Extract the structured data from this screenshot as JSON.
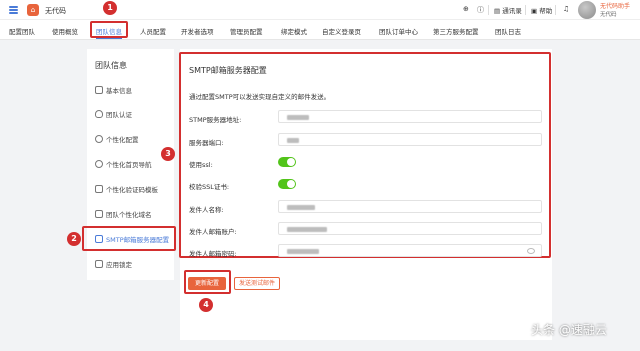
{
  "app": {
    "title": "无代码",
    "home_glyph": "⌂"
  },
  "top_right": {
    "address_book": "通讯录",
    "help": "帮助",
    "user_name": "无代码助手",
    "user_role": "无代码"
  },
  "nav": {
    "tabs": [
      "配置团队",
      "使用概览",
      "团队信息",
      "人员配置",
      "开发者选项",
      "管理员配置",
      "绑定模式",
      "自定义登录页",
      "团队订单中心",
      "第三方服务配置",
      "团队日志"
    ],
    "active_tab": "团队信息"
  },
  "left": {
    "title": "团队信息",
    "items": [
      "基本信息",
      "团队认证",
      "个性化配置",
      "个性化首页导航",
      "个性化验证码模板",
      "团队个性化域名",
      "SMTP邮箱服务器配置",
      "应用锁定"
    ],
    "active_item": "SMTP邮箱服务器配置"
  },
  "main": {
    "title": "SMTP邮箱服务器配置",
    "description": "通过配置SMTP可以发送实现自定义的邮件发送。",
    "fields": {
      "server_address": {
        "label": "STMP服务器地址:"
      },
      "server_port": {
        "label": "服务器端口:"
      },
      "use_ssl": {
        "label": "使用ssl:",
        "on": true
      },
      "verify_ssl": {
        "label": "校验SSL证书:",
        "on": true
      },
      "sender_name": {
        "label": "发件人名称:"
      },
      "sender_account": {
        "label": "发件人邮箱账户:"
      },
      "sender_password": {
        "label": "发件人邮箱密码:"
      }
    },
    "update_button": "更新配置",
    "test_button": "发送测试邮件"
  },
  "annotations": [
    "1",
    "2",
    "3",
    "4"
  ],
  "watermark": "头条 @速融云",
  "colors": {
    "accent": "#4a7bd8",
    "brand": "#e8643c",
    "toggle_on": "#52c41a",
    "annotation": "#d32f2f"
  }
}
